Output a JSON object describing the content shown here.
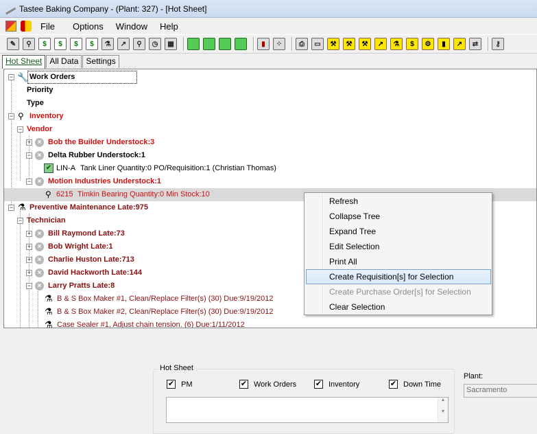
{
  "window": {
    "title": "Tastee Baking Company - (Plant: 327) - [Hot Sheet]"
  },
  "menu": {
    "items": [
      "File",
      "Options",
      "Window",
      "Help"
    ]
  },
  "tabs": [
    "Hot Sheet",
    "All Data",
    "Settings"
  ],
  "tree": {
    "work_orders": "Work Orders",
    "priority": "Priority",
    "type": "Type",
    "inventory": "Inventory",
    "vendor": "Vendor",
    "bob_builder": "Bob the Builder Understock:3",
    "delta_rubber": "Delta Rubber Understock:1",
    "lin_a_code": "LIN-A",
    "lin_a_text": "Tank Liner Quantity:0 PO/Requisition:1 (Christian Thomas)",
    "motion": "Motion Industries Understock:1",
    "item_6215_code": "6215",
    "item_6215_text": "Timkin Bearing Quantity:0 Min Stock:10",
    "pm_late": "Preventive Maintenance Late:975",
    "technician": "Technician",
    "bill": "Bill Raymond Late:73",
    "bob_wright": "Bob Wright Late:1",
    "charlie": "Charlie Huston Late:713",
    "david": "David Hackworth Late:144",
    "larry": "Larry Pratts Late:8",
    "task1": "B & S Box Maker #1, Clean/Replace Filter(s) (30) Due:9/19/2012",
    "task2": "B & S Box Maker #2, Clean/Replace Filter(s) (30) Due:9/19/2012",
    "task3": "Case Sealer #1, Adjust chain tension. (6) Due:1/11/2012"
  },
  "context_menu": {
    "refresh": "Refresh",
    "collapse": "Collapse Tree",
    "expand": "Expand Tree",
    "edit": "Edit Selection",
    "print": "Print All",
    "create_req": "Create Requisition[s] for Selection",
    "create_po": "Create Purchase Order[s] for Selection",
    "clear": "Clear Selection"
  },
  "hot_sheet": {
    "title": "Hot Sheet",
    "pm": "PM",
    "work_orders": "Work Orders",
    "inventory": "Inventory",
    "down_time": "Down Time",
    "check": "✔"
  },
  "plant": {
    "label": "Plant:",
    "value": "Sacramento"
  }
}
